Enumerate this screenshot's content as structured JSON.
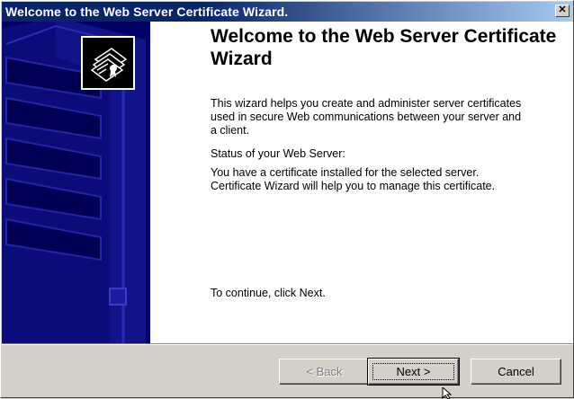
{
  "window": {
    "title": "Welcome to the Web Server Certificate Wizard.",
    "close_glyph": "✕"
  },
  "content": {
    "heading": "Welcome to the Web Server Certificate Wizard",
    "intro": "This wizard helps you create and administer server certificates used in secure Web communications between your server and a client.",
    "status_label": "Status of your Web Server:",
    "status_text": "You have a certificate installed for the selected server. Certificate Wizard will help you to manage this certificate.",
    "continue_text": "To continue, click Next."
  },
  "buttons": {
    "back": "< Back",
    "next": "Next >",
    "cancel": "Cancel"
  },
  "icons": {
    "banner": "server-tower-icon",
    "certificate": "certificate-icon",
    "cursor": "mouse-pointer-icon"
  },
  "colors": {
    "titlebar": "#0a246a",
    "banner": "#000066",
    "face": "#d4d0c8"
  }
}
